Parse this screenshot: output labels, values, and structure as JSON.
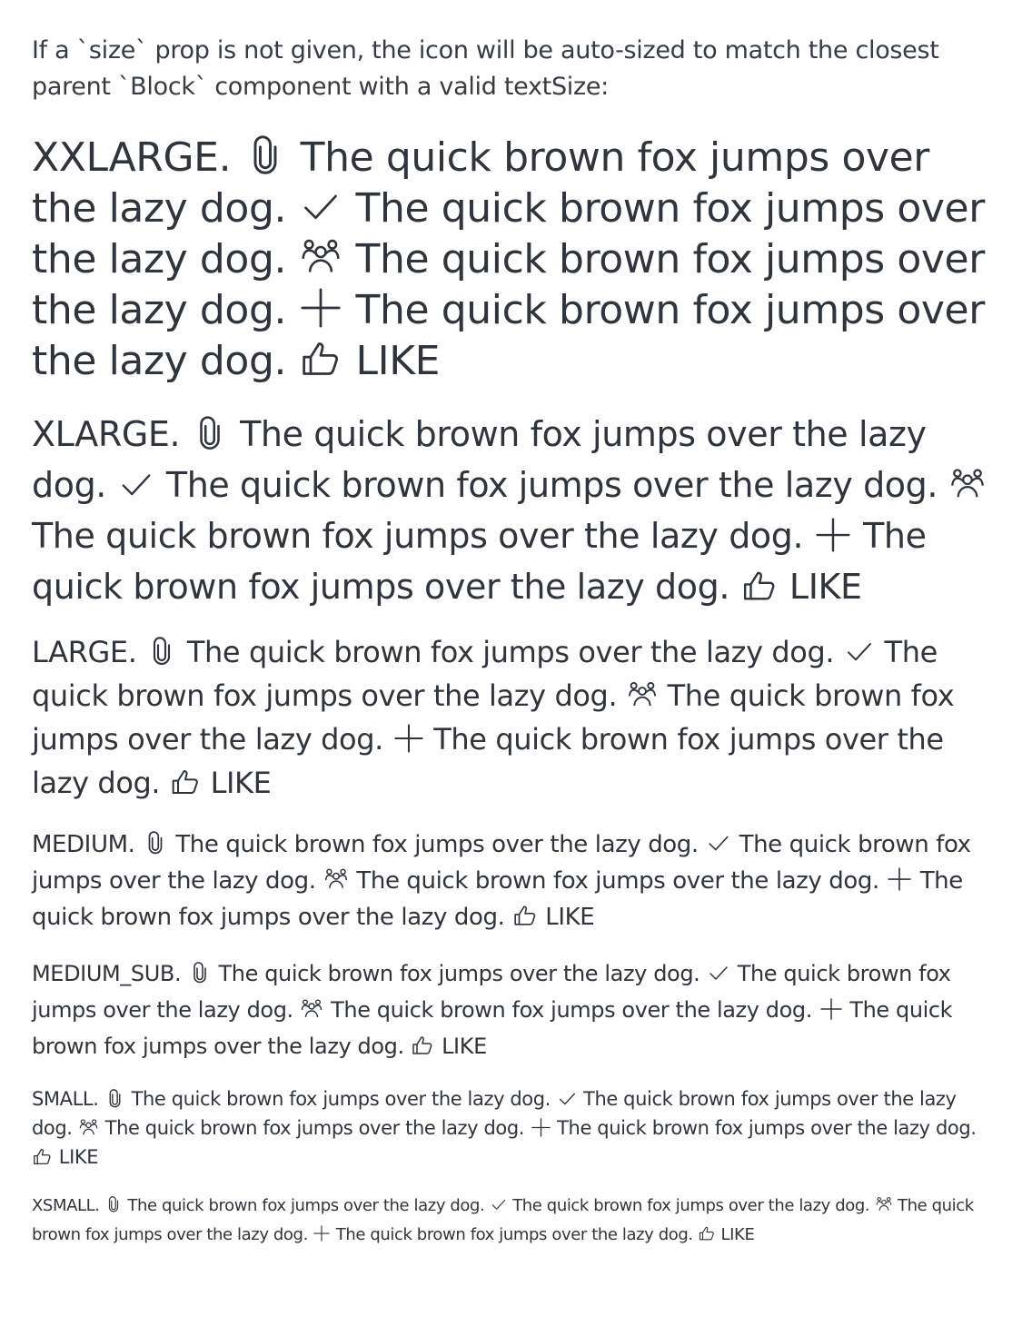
{
  "intro": "If a `size` prop is not given, the icon will be auto-sized to match the closest parent `Block` component with a valid textSize:",
  "sentence": "The quick brown fox jumps over the lazy dog.",
  "like_label": "LIKE",
  "icons": [
    "paperclip-icon",
    "checkmark-icon",
    "group-icon",
    "plus-icon",
    "thumbs-up-icon"
  ],
  "colors": {
    "text": "#2f343d",
    "intro_text": "#363b44",
    "background": "#ffffff"
  },
  "blocks": [
    {
      "label": "XXLARGE."
    },
    {
      "label": "XLARGE."
    },
    {
      "label": "LARGE."
    },
    {
      "label": "MEDIUM."
    },
    {
      "label": "MEDIUM_SUB."
    },
    {
      "label": "SMALL."
    },
    {
      "label": "XSMALL."
    }
  ]
}
